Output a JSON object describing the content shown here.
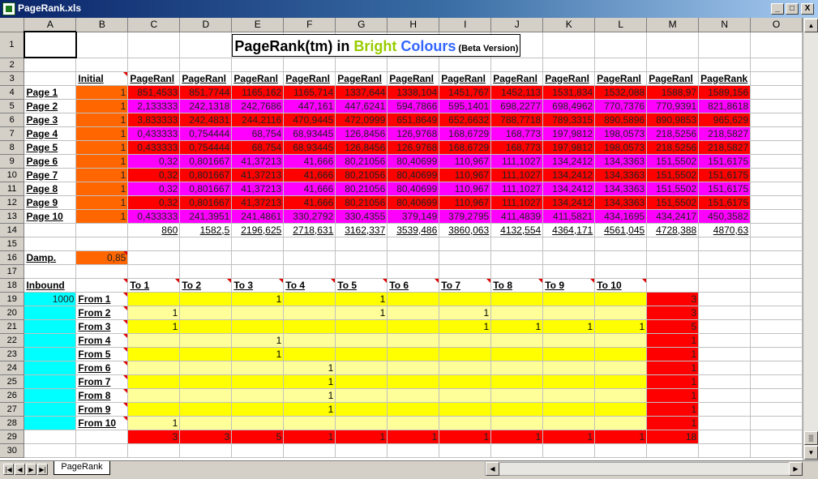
{
  "window": {
    "title": "PageRank.xls",
    "btn_min": "_",
    "btn_max": "□",
    "btn_close": "X"
  },
  "columns": [
    "A",
    "B",
    "C",
    "D",
    "E",
    "F",
    "G",
    "H",
    "I",
    "J",
    "K",
    "L",
    "M",
    "N",
    "O"
  ],
  "title": {
    "part1": "PageRank(tm) in ",
    "part2": "Bright",
    "part3": " Colours",
    "part4": " (Beta Version)",
    "color2": "#99cc00",
    "color3": "#3366ff"
  },
  "header_initial": "Initial",
  "pagerank_headers": [
    "PageRanl",
    "PageRanl",
    "PageRanl",
    "PageRanl",
    "PageRanl",
    "PageRanl",
    "PageRanl",
    "PageRanl",
    "PageRanl",
    "PageRanl",
    "PageRanl",
    "PageRank"
  ],
  "pages": [
    {
      "label": "Page 1",
      "initial": "1",
      "values": [
        "851,4533",
        "851,7744",
        "1165,162",
        "1165,714",
        "1337,644",
        "1338,104",
        "1451,767",
        "1452,113",
        "1531,834",
        "1532,088",
        "1588,97",
        "1589,156"
      ]
    },
    {
      "label": "Page 2",
      "initial": "1",
      "values": [
        "2,133333",
        "242,1318",
        "242,7686",
        "447,161",
        "447,6241",
        "594,7866",
        "595,1401",
        "698,2277",
        "698,4962",
        "770,7376",
        "770,9391",
        "821,8618"
      ]
    },
    {
      "label": "Page 3",
      "initial": "1",
      "values": [
        "3,833333",
        "242,4831",
        "244,2116",
        "470,9445",
        "472,0999",
        "651,8649",
        "652,6632",
        "788,7718",
        "789,3315",
        "890,5896",
        "890,9853",
        "965,629"
      ]
    },
    {
      "label": "Page 4",
      "initial": "1",
      "values": [
        "0,433333",
        "0,754444",
        "68,754",
        "68,93445",
        "126,8456",
        "126,9768",
        "168,6729",
        "168,773",
        "197,9812",
        "198,0573",
        "218,5256",
        "218,5827"
      ]
    },
    {
      "label": "Page 5",
      "initial": "1",
      "values": [
        "0,433333",
        "0,754444",
        "68,754",
        "68,93445",
        "126,8456",
        "126,9768",
        "168,6729",
        "168,773",
        "197,9812",
        "198,0573",
        "218,5256",
        "218,5827"
      ]
    },
    {
      "label": "Page 6",
      "initial": "1",
      "values": [
        "0,32",
        "0,801667",
        "41,37213",
        "41,666",
        "80,21056",
        "80,40699",
        "110,967",
        "111,1027",
        "134,2412",
        "134,3363",
        "151,5502",
        "151,6175"
      ]
    },
    {
      "label": "Page 7",
      "initial": "1",
      "values": [
        "0,32",
        "0,801667",
        "41,37213",
        "41,666",
        "80,21056",
        "80,40699",
        "110,967",
        "111,1027",
        "134,2412",
        "134,3363",
        "151,5502",
        "151,6175"
      ]
    },
    {
      "label": "Page 8",
      "initial": "1",
      "values": [
        "0,32",
        "0,801667",
        "41,37213",
        "41,666",
        "80,21056",
        "80,40699",
        "110,967",
        "111,1027",
        "134,2412",
        "134,3363",
        "151,5502",
        "151,6175"
      ]
    },
    {
      "label": "Page 9",
      "initial": "1",
      "values": [
        "0,32",
        "0,801667",
        "41,37213",
        "41,666",
        "80,21056",
        "80,40699",
        "110,967",
        "111,1027",
        "134,2412",
        "134,3363",
        "151,5502",
        "151,6175"
      ]
    },
    {
      "label": "Page 10",
      "initial": "1",
      "values": [
        "0,433333",
        "241,3951",
        "241,4861",
        "330,2792",
        "330,4355",
        "379,149",
        "379,2795",
        "411,4839",
        "411,5821",
        "434,1695",
        "434,2417",
        "450,3582"
      ]
    }
  ],
  "sums": [
    "860",
    "1582,5",
    "2196,625",
    "2718,631",
    "3162,337",
    "3539,486",
    "3860,063",
    "4132,554",
    "4364,171",
    "4561,045",
    "4728,388",
    "4870,63"
  ],
  "damp": {
    "label": "Damp.",
    "value": "0,85"
  },
  "inbound": {
    "label": "Inbound",
    "value": "1000"
  },
  "to_headers": [
    "To 1",
    "To 2",
    "To 3",
    "To 4",
    "To 5",
    "To 6",
    "To 7",
    "To 8",
    "To 9",
    "To 10"
  ],
  "links": [
    {
      "label": "From 1",
      "cells": [
        "",
        "",
        "1",
        "",
        "1",
        "",
        "",
        "",
        "",
        "",
        "1"
      ],
      "count": "3"
    },
    {
      "label": "From 2",
      "cells": [
        "1",
        "",
        "",
        "",
        "1",
        "",
        "1",
        "",
        "",
        "",
        ""
      ],
      "count": "3"
    },
    {
      "label": "From 3",
      "cells": [
        "1",
        "",
        "",
        "",
        "",
        "",
        "1",
        "1",
        "1",
        "1",
        ""
      ],
      "count": "5"
    },
    {
      "label": "From 4",
      "cells": [
        "",
        "",
        "1",
        "",
        "",
        "",
        "",
        "",
        "",
        "",
        ""
      ],
      "count": "1"
    },
    {
      "label": "From 5",
      "cells": [
        "",
        "",
        "1",
        "",
        "",
        "",
        "",
        "",
        "",
        "",
        ""
      ],
      "count": "1"
    },
    {
      "label": "From 6",
      "cells": [
        "",
        "",
        "",
        "1",
        "",
        "",
        "",
        "",
        "",
        "",
        ""
      ],
      "count": "1"
    },
    {
      "label": "From 7",
      "cells": [
        "",
        "",
        "",
        "1",
        "",
        "",
        "",
        "",
        "",
        "",
        ""
      ],
      "count": "1"
    },
    {
      "label": "From 8",
      "cells": [
        "",
        "",
        "",
        "1",
        "",
        "",
        "",
        "",
        "",
        "",
        ""
      ],
      "count": "1"
    },
    {
      "label": "From 9",
      "cells": [
        "",
        "",
        "",
        "1",
        "",
        "",
        "",
        "",
        "",
        "",
        ""
      ],
      "count": "1"
    },
    {
      "label": "From 10",
      "cells": [
        "1",
        "",
        "",
        "",
        "",
        "",
        "",
        "",
        "",
        "",
        ""
      ],
      "count": "1"
    }
  ],
  "to_counts": [
    "3",
    "3",
    "5",
    "1",
    "1",
    "1",
    "1",
    "1",
    "1",
    "1"
  ],
  "to_total": "18",
  "sheet_tab": "PageRank"
}
